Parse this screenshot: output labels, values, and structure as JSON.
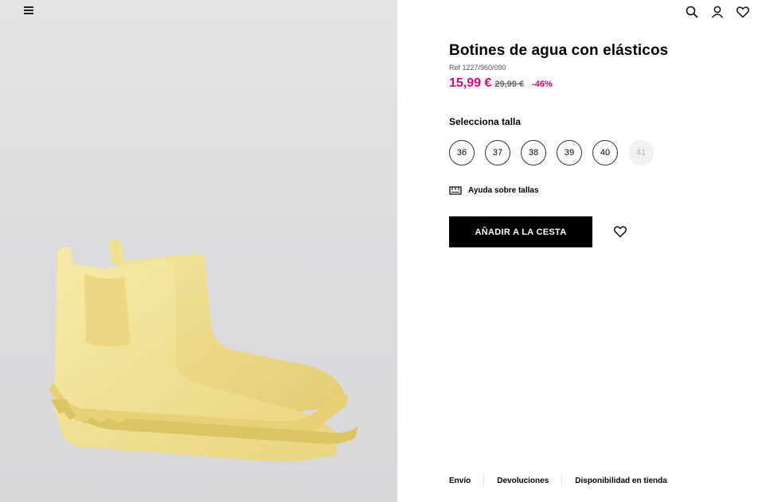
{
  "header": {
    "menu_icon": "hamburger-menu-icon",
    "icons": [
      "search-icon",
      "user-icon",
      "heart-icon"
    ]
  },
  "product": {
    "title": "Botines de agua con elásticos",
    "ref": "Ref 1227/960/090",
    "price_current": "15,99 €",
    "price_old": "29,99 €",
    "discount": "-46%",
    "image_alt": "yellow rubber chelsea rain boots"
  },
  "sizes": {
    "label": "Selecciona talla",
    "options": [
      {
        "value": "36",
        "available": true
      },
      {
        "value": "37",
        "available": true
      },
      {
        "value": "38",
        "available": true
      },
      {
        "value": "39",
        "available": true
      },
      {
        "value": "40",
        "available": true
      },
      {
        "value": "41",
        "available": false
      }
    ],
    "help_label": "Ayuda sobre tallas"
  },
  "actions": {
    "add_to_cart": "AÑADIR A LA CESTA",
    "wishlist_icon": "heart-icon"
  },
  "footer": {
    "links": [
      "Envío",
      "Devoluciones",
      "Disponibilidad en tienda"
    ]
  },
  "colors": {
    "accent_price": "#e6007e",
    "button_bg": "#000000",
    "boot_color": "#f1e29a"
  }
}
